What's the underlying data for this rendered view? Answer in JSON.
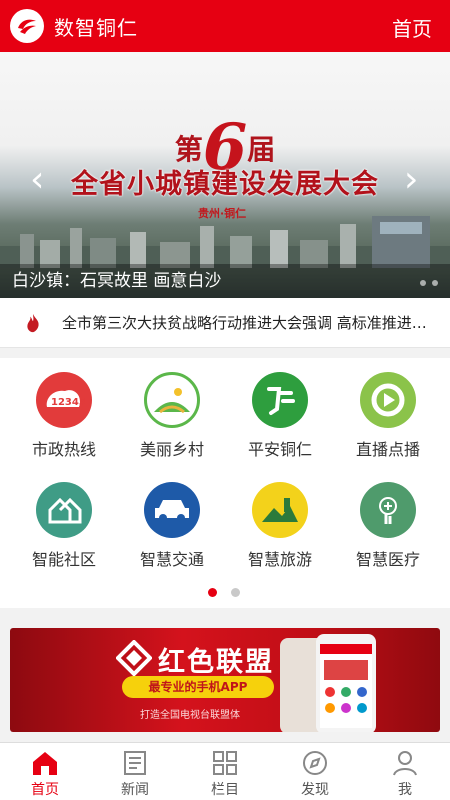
{
  "header": {
    "app_title": "数智铜仁",
    "home_link": "首页"
  },
  "banner": {
    "line_prefix": "第",
    "line_number": "6",
    "line_suffix": "届",
    "headline": "全省小城镇建设发展大会",
    "location": "贵州·铜仁",
    "caption": "白沙镇：石冥故里 画意白沙"
  },
  "ticker": {
    "text": "全市第三次大扶贫战略行动推进大会强调 高标准推进…"
  },
  "services": [
    {
      "label": "市政热线",
      "icon": "hotline-icon",
      "color": "#e23b3b"
    },
    {
      "label": "美丽乡村",
      "icon": "village-icon",
      "color": "#5bb74a"
    },
    {
      "label": "平安铜仁",
      "icon": "safety-icon",
      "color": "#2e9e3e"
    },
    {
      "label": "直播点播",
      "icon": "live-icon",
      "color": "#8bc34a"
    },
    {
      "label": "智能社区",
      "icon": "community-icon",
      "color": "#3f9c86"
    },
    {
      "label": "智慧交通",
      "icon": "car-icon",
      "color": "#1e5aa8"
    },
    {
      "label": "智慧旅游",
      "icon": "travel-icon",
      "color": "#f3d21b"
    },
    {
      "label": "智慧医疗",
      "icon": "medical-icon",
      "color": "#4f9b6c"
    }
  ],
  "pager": {
    "pages": 2,
    "active": 1
  },
  "ad": {
    "title": "红色联盟",
    "pill": "最专业的手机APP",
    "subtitle": "打造全国电视台联盟体"
  },
  "tabs": [
    {
      "label": "首页",
      "icon": "home-icon",
      "active": true
    },
    {
      "label": "新闻",
      "icon": "news-icon",
      "active": false
    },
    {
      "label": "栏目",
      "icon": "columns-icon",
      "active": false
    },
    {
      "label": "发现",
      "icon": "compass-icon",
      "active": false
    },
    {
      "label": "我",
      "icon": "user-icon",
      "active": false
    }
  ],
  "colors": {
    "brand": "#e60012"
  }
}
